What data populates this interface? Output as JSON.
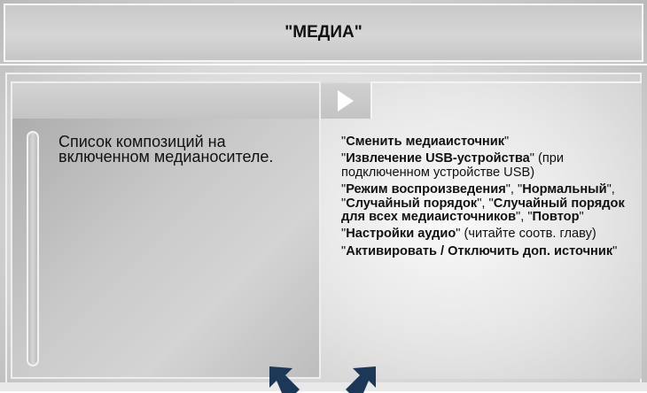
{
  "header": {
    "title": "\"МЕДИА\""
  },
  "left_panel": {
    "description": "Список композиций на включенном медианосителе."
  },
  "right_panel": {
    "items": [
      [
        {
          "text": "\"",
          "bold": false
        },
        {
          "text": "Сменить медиаисточник",
          "bold": true
        },
        {
          "text": "\"",
          "bold": false
        }
      ],
      [
        {
          "text": "\"",
          "bold": false
        },
        {
          "text": "Извлечение USB-устройства",
          "bold": true
        },
        {
          "text": "\" (при подключенном устройстве USB)",
          "bold": false
        }
      ],
      [
        {
          "text": "\"",
          "bold": false
        },
        {
          "text": "Режим воспроизведения",
          "bold": true
        },
        {
          "text": "\", \"",
          "bold": false
        },
        {
          "text": "Нормальный",
          "bold": true
        },
        {
          "text": "\", \"",
          "bold": false
        },
        {
          "text": "Случайный порядок",
          "bold": true
        },
        {
          "text": "\", \"",
          "bold": false
        },
        {
          "text": "Случайный порядок для всех медиаисточников",
          "bold": true
        },
        {
          "text": "\", \"",
          "bold": false
        },
        {
          "text": "Повтор",
          "bold": true
        },
        {
          "text": "\"",
          "bold": false
        }
      ],
      [
        {
          "text": "\"",
          "bold": false
        },
        {
          "text": "Настройки аудио",
          "bold": true
        },
        {
          "text": "\" (читайте соотв. главу)",
          "bold": false
        }
      ],
      [
        {
          "text": "\"",
          "bold": false
        },
        {
          "text": "Активировать / Отключить доп. источник",
          "bold": true
        },
        {
          "text": "\"",
          "bold": false
        }
      ]
    ]
  },
  "icons": {
    "play": "play-icon",
    "arrow_left": "arrow-up-left-icon",
    "arrow_right": "arrow-up-right-icon",
    "arrow_color": "#1d3857"
  }
}
